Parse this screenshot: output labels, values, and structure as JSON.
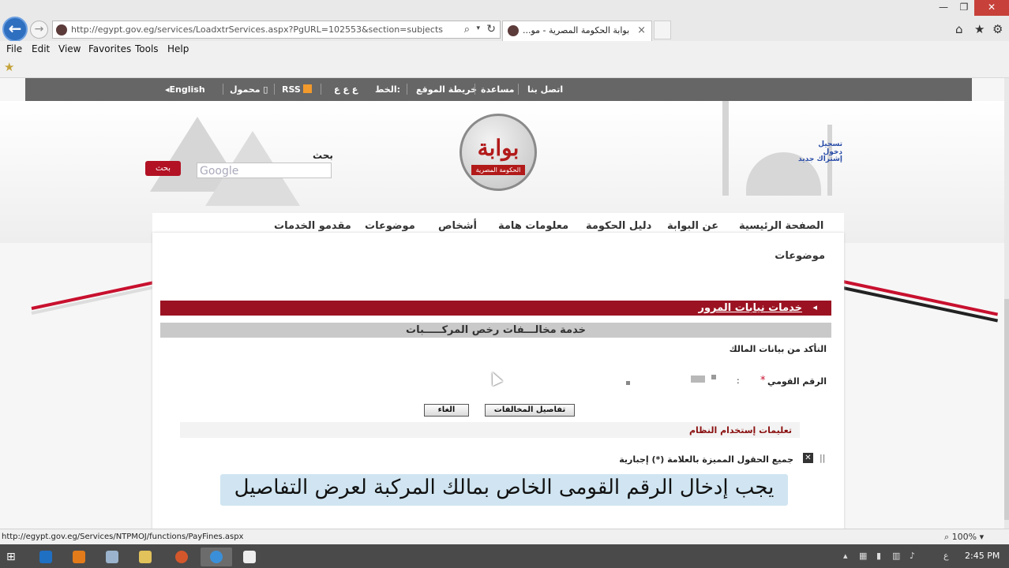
{
  "browser": {
    "url": "http://egypt.gov.eg/services/LoadxtrServices.aspx?PgURL=102553&section=subjects",
    "tab_title": "بوابة الحكومة المصرية - مو...",
    "tab_close": "×",
    "menu": [
      "File",
      "Edit",
      "View",
      "Favorites",
      "Tools",
      "Help"
    ],
    "status_url": "http://egypt.gov.eg/Services/NTPMOJ/functions/PayFines.aspx",
    "zoom": "100%"
  },
  "topstrip": {
    "english": "English",
    "mobile": "محمول",
    "rss": "RSS",
    "font_sizes": "ع ع ع",
    "font_label": "الخط:",
    "sitemap": "خريطة الموقع",
    "help": "مساعدة",
    "contact": "اتصل بنا"
  },
  "header": {
    "logo_main": "بوابة",
    "logo_sub": "الحكومة المصرية",
    "search_label": "بحث",
    "search_placeholder": "Google",
    "search_button": "بحث",
    "login": "تسجيل دخول",
    "signup": "إشتراك جديد"
  },
  "nav": {
    "items": [
      "الصفحة الرئيسية",
      "عن البوابة",
      "دليل الحكومة",
      "معلومات هامة",
      "أشخاص",
      "موضوعات",
      "مقدمو الخدمات"
    ]
  },
  "content": {
    "title": "موضوعات",
    "section_link": "خدمات نيابات المرور",
    "service_title": "خدمة مخالـــفات رخص المركـــــبات",
    "owner_check": "التأكد من بيانات المالك",
    "national_id_label": "الرقم القومي",
    "required_mark": "*",
    "colon": ":",
    "details_button": "تفاصيل المخالفات",
    "cancel_button": "الغاء",
    "instructions": "تعليمات إستخدام النظام",
    "required_note": "جميع الحقول المميزة بالعلامة (*) إجبارية"
  },
  "caption": "يجب إدخال الرقم القومى الخاص بمالك المركبة لعرض التفاصيل",
  "taskbar": {
    "clock": "2:45 PM",
    "lang": "ع"
  },
  "colors": {
    "brand_red": "#9b1322",
    "nav_grey": "#666666",
    "link_blue": "#2a4da8"
  }
}
